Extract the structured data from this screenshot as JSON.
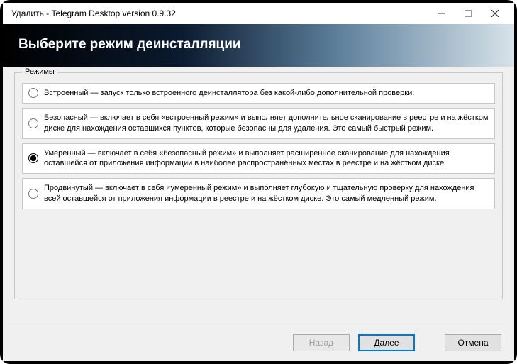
{
  "window": {
    "title": "Удалить - Telegram Desktop version 0.9.32"
  },
  "header": {
    "title": "Выберите режим деинсталляции"
  },
  "group": {
    "label": "Режимы"
  },
  "options": [
    {
      "label": "Встроенный — запуск только встроенного деинсталлятора без какой-либо дополнительной проверки.",
      "selected": false
    },
    {
      "label": "Безопасный — включает в себя «встроенный режим» и выполняет дополнительное сканирование в реестре и на жёстком диске для нахождения оставшихся пунктов, которые безопасны для удаления. Это самый быстрый режим.",
      "selected": false
    },
    {
      "label": "Умеренный — включает в себя «безопасный режим» и выполняет расширенное сканирование для нахождения оставшейся от приложения информации в наиболее распространённых местах в реестре и на жёстком диске.",
      "selected": true
    },
    {
      "label": "Продвинутый — включает в себя «умеренный режим» и выполняет глубокую и тщательную проверку для нахождения всей оставшейся от приложения информации в реестре и на жёстком диске. Это самый медленный режим.",
      "selected": false
    }
  ],
  "buttons": {
    "back": "Назад",
    "next": "Далее",
    "cancel": "Отмена"
  }
}
